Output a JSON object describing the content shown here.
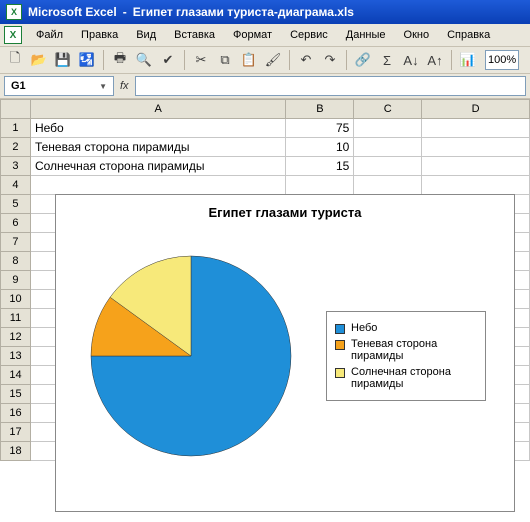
{
  "titlebar": {
    "app": "Microsoft Excel",
    "sep": " - ",
    "doc": "Египет глазами туриста-диаграма.xls"
  },
  "menu": {
    "file": "Файл",
    "edit": "Правка",
    "view": "Вид",
    "insert": "Вставка",
    "format": "Формат",
    "tools": "Сервис",
    "data": "Данные",
    "window": "Окно",
    "help": "Справка"
  },
  "toolbar": {
    "zoom": "100%"
  },
  "formula": {
    "name_box": "G1",
    "fx": "fx"
  },
  "columns": {
    "A": "A",
    "B": "B",
    "C": "C",
    "D": "D"
  },
  "rows": [
    "1",
    "2",
    "3",
    "4",
    "5",
    "6",
    "7",
    "8",
    "9",
    "10",
    "11",
    "12",
    "13",
    "14",
    "15",
    "16",
    "17",
    "18"
  ],
  "cells": {
    "A1": "Небо",
    "B1": "75",
    "A2": "Теневая сторона пирамиды",
    "B2": "10",
    "A3": "Солнечная сторона пирамиды",
    "B3": "15"
  },
  "chart_data": {
    "type": "pie",
    "title": "Египет глазами туриста",
    "series": [
      {
        "name": "Небо",
        "value": 75,
        "color": "#1f8fd8"
      },
      {
        "name": "Теневая сторона пирамиды",
        "value": 10,
        "color": "#f6a21b"
      },
      {
        "name": "Солнечная сторона пирамиды",
        "value": 15,
        "color": "#f7e97a"
      }
    ],
    "legend_position": "right"
  }
}
